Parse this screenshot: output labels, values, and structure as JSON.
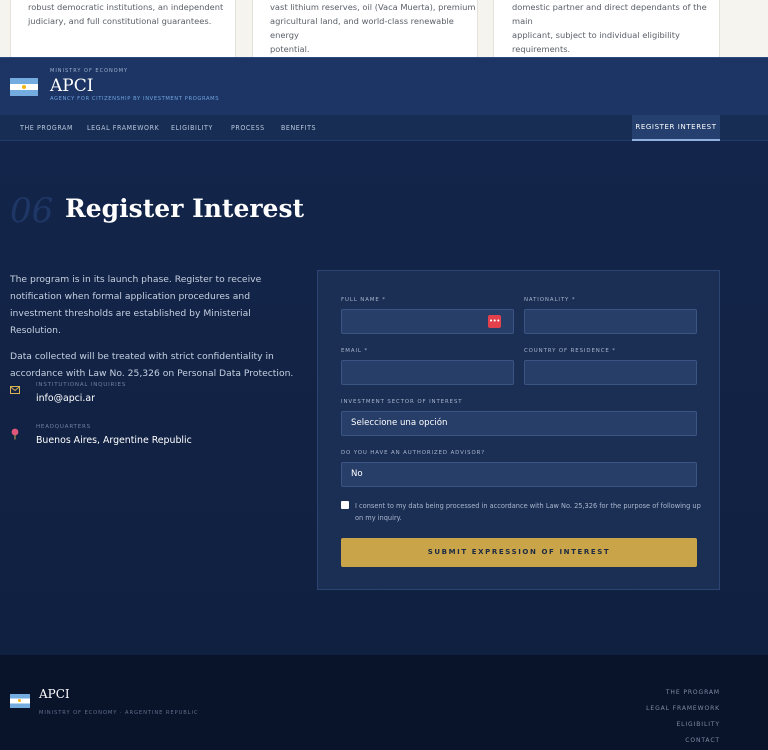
{
  "cards": [
    {
      "lines": [
        "robust democratic institutions, an independent",
        "judiciary, and full constitutional guarantees."
      ]
    },
    {
      "lines": [
        "vast lithium reserves, oil (Vaca Muerta), premium",
        "agricultural land, and world-class renewable energy",
        "potential."
      ]
    },
    {
      "lines": [
        "domestic partner and direct dependants of the main",
        "applicant, subject to individual eligibility",
        "requirements."
      ]
    }
  ],
  "brand": {
    "ministry": "MINISTRY OF ECONOMY",
    "name": "APCI",
    "subtitle": "AGENCY FOR CITIZENSHIP BY INVESTMENT PROGRAMS"
  },
  "nav": {
    "items": [
      "THE PROGRAM",
      "LEGAL FRAMEWORK",
      "ELIGIBILITY",
      "PROCESS",
      "BENEFITS"
    ],
    "cta": "REGISTER INTEREST"
  },
  "section": {
    "number": "06",
    "title": "Register Interest"
  },
  "intro": {
    "paragraph1": "The program is in its launch phase. Register to receive notification when formal application procedures and investment thresholds are established by Ministerial Resolution.",
    "paragraph2": "Data collected will be treated with strict confidentiality in accordance with Law No. 25,326 on Personal Data Protection."
  },
  "contact": {
    "email_label": "INSTITUTIONAL INQUIRIES",
    "email_value": "info@apci.ar",
    "hq_label": "HEADQUARTERS",
    "hq_value": "Buenos Aires, Argentine Republic"
  },
  "form": {
    "full_name_label": "FULL NAME *",
    "nationality_label": "NATIONALITY *",
    "email_label": "EMAIL *",
    "country_label": "COUNTRY OF RESIDENCE *",
    "sector_label": "INVESTMENT SECTOR OF INTEREST",
    "sector_value": "Seleccione una opción",
    "advisor_label": "DO YOU HAVE AN AUTHORIZED ADVISOR?",
    "advisor_value": "No",
    "consent": "I consent to my data being processed in accordance with Law No. 25,326 for the purpose of following up on my inquiry.",
    "submit": "SUBMIT EXPRESSION OF INTEREST",
    "password_manager_icon": "•••"
  },
  "footer": {
    "name": "APCI",
    "subtitle": "MINISTRY OF ECONOMY · ARGENTINE REPUBLIC",
    "links": [
      "THE PROGRAM",
      "LEGAL FRAMEWORK",
      "ELIGIBILITY",
      "CONTACT"
    ]
  },
  "colors": {
    "accent_gold": "#c9a448",
    "header_blue": "#1c3564",
    "page_navy": "#13254a"
  }
}
